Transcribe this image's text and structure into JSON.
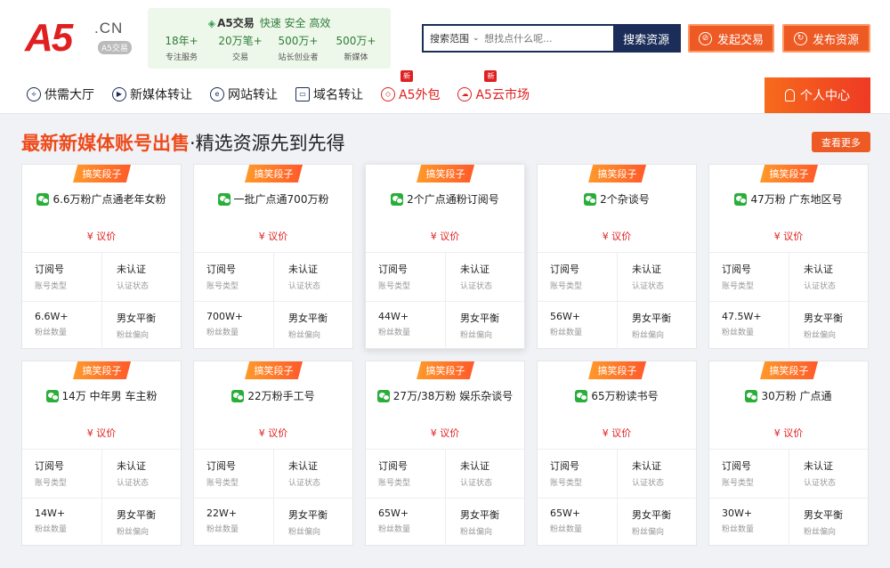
{
  "logo": {
    "main": "A5",
    "suffix": ".CN",
    "tag": "A5交易"
  },
  "stats": {
    "title": "A5交易",
    "slogan": "快速 安全 高效",
    "items": [
      {
        "num": "18年+",
        "label": "专注服务"
      },
      {
        "num": "20万笔+",
        "label": "交易"
      },
      {
        "num": "500万+",
        "label": "站长创业者"
      },
      {
        "num": "500万+",
        "label": "新媒体"
      }
    ]
  },
  "search": {
    "scope": "搜索范围",
    "placeholder": "想找点什么呢...",
    "button": "搜索资源"
  },
  "actions": {
    "start_trade": "发起交易",
    "publish": "发布资源"
  },
  "nav": [
    {
      "label": "供需大厅",
      "icon": "market-icon",
      "badge": ""
    },
    {
      "label": "新媒体转让",
      "icon": "media-icon",
      "badge": ""
    },
    {
      "label": "网站转让",
      "icon": "globe-icon",
      "badge": ""
    },
    {
      "label": "域名转让",
      "icon": "domain-icon",
      "badge": ""
    },
    {
      "label": "A5外包",
      "icon": "diamond-icon",
      "badge": "新"
    },
    {
      "label": "A5云市场",
      "icon": "cloud-icon",
      "badge": "新"
    }
  ],
  "user_center": "个人中心",
  "section": {
    "title_highlight": "最新新媒体账号出售",
    "title_rest": "·精选资源先到先得",
    "more": "查看更多"
  },
  "card_labels": {
    "type": "账号类型",
    "auth": "认证状态",
    "fans": "粉丝数量",
    "bias": "粉丝偏向"
  },
  "cards": [
    {
      "tag": "搞笑段子",
      "title": "6.6万粉广点通老年女粉",
      "price": "¥ 议价",
      "type": "订阅号",
      "auth": "未认证",
      "fans": "6.6W+",
      "bias": "男女平衡"
    },
    {
      "tag": "搞笑段子",
      "title": "一批广点通700万粉",
      "price": "¥ 议价",
      "type": "订阅号",
      "auth": "未认证",
      "fans": "700W+",
      "bias": "男女平衡"
    },
    {
      "tag": "搞笑段子",
      "title": "2个广点通粉订阅号",
      "price": "¥ 议价",
      "type": "订阅号",
      "auth": "未认证",
      "fans": "44W+",
      "bias": "男女平衡"
    },
    {
      "tag": "搞笑段子",
      "title": "2个杂谈号",
      "price": "¥ 议价",
      "type": "订阅号",
      "auth": "未认证",
      "fans": "56W+",
      "bias": "男女平衡"
    },
    {
      "tag": "搞笑段子",
      "title": "47万粉 广东地区号",
      "price": "¥ 议价",
      "type": "订阅号",
      "auth": "未认证",
      "fans": "47.5W+",
      "bias": "男女平衡"
    },
    {
      "tag": "搞笑段子",
      "title": "14万 中年男 车主粉",
      "price": "¥ 议价",
      "type": "订阅号",
      "auth": "未认证",
      "fans": "14W+",
      "bias": "男女平衡"
    },
    {
      "tag": "搞笑段子",
      "title": "22万粉手工号",
      "price": "¥ 议价",
      "type": "订阅号",
      "auth": "未认证",
      "fans": "22W+",
      "bias": "男女平衡"
    },
    {
      "tag": "搞笑段子",
      "title": "27万/38万粉 娱乐杂谈号",
      "price": "¥ 议价",
      "type": "订阅号",
      "auth": "未认证",
      "fans": "65W+",
      "bias": "男女平衡"
    },
    {
      "tag": "搞笑段子",
      "title": "65万粉读书号",
      "price": "¥ 议价",
      "type": "订阅号",
      "auth": "未认证",
      "fans": "65W+",
      "bias": "男女平衡"
    },
    {
      "tag": "搞笑段子",
      "title": "30万粉 广点通",
      "price": "¥ 议价",
      "type": "订阅号",
      "auth": "未认证",
      "fans": "30W+",
      "bias": "男女平衡"
    }
  ]
}
